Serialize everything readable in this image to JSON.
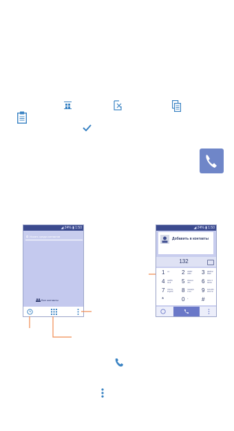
{
  "colors": {
    "accent": "#3a83c3",
    "callout": "#ef8a4f",
    "screen": "#c8cdee",
    "statusbar": "#3b4a8e"
  },
  "icons": {
    "row1": [
      "grid-icon",
      "cross-edit-icon",
      "copy-icon"
    ],
    "paste": "clipboard-icon",
    "check": "checkmark-icon",
    "big_call": "phone-icon",
    "small_call": "phone-icon",
    "more": "more-vertical-icon"
  },
  "phone1": {
    "status": "◢ 24% ▮ 1:50",
    "search_placeholder": "Искать среди контактов",
    "all_contacts": "Все контакты"
  },
  "phone2": {
    "status": "◢ 24% ▮ 1:50",
    "add_contact": "Добавить в контакты",
    "number": "132",
    "keys": [
      {
        "digit": "1",
        "letters": "oo"
      },
      {
        "digit": "2",
        "letters": "АБВГ ABC"
      },
      {
        "digit": "3",
        "letters": "ДЕЁЖ DEF"
      },
      {
        "digit": "4",
        "letters": "ЗИЙК GHI"
      },
      {
        "digit": "5",
        "letters": "ЛМНО JKL"
      },
      {
        "digit": "6",
        "letters": "ПРСТ MNO"
      },
      {
        "digit": "7",
        "letters": "УФХЦ PQRS"
      },
      {
        "digit": "8",
        "letters": "ЧШЩЪ TUV"
      },
      {
        "digit": "9",
        "letters": "ЫЬЭЮ WXYZ"
      },
      {
        "digit": "*",
        "letters": ""
      },
      {
        "digit": "0",
        "letters": "+"
      },
      {
        "digit": "#",
        "letters": ""
      }
    ]
  }
}
